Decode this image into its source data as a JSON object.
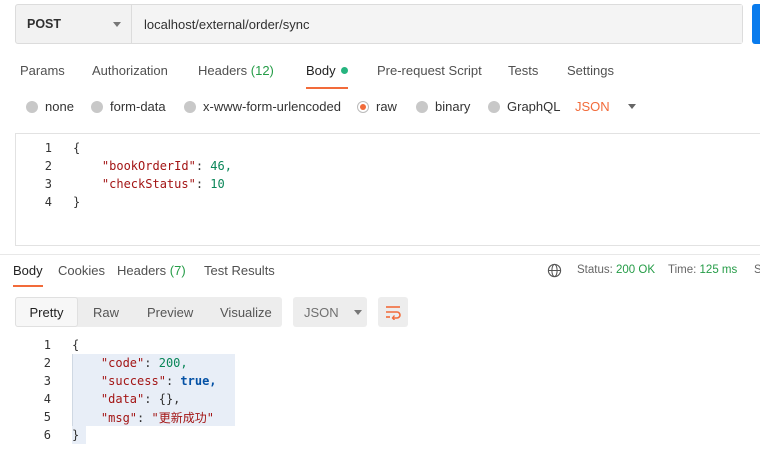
{
  "request": {
    "method": "POST",
    "url": "localhost/external/order/sync"
  },
  "request_tabs": [
    {
      "label": "Params"
    },
    {
      "label": "Authorization"
    },
    {
      "label": "Headers",
      "count": "(12)"
    },
    {
      "label": "Body",
      "active": true
    },
    {
      "label": "Pre-request Script"
    },
    {
      "label": "Tests"
    },
    {
      "label": "Settings"
    }
  ],
  "body_types": [
    {
      "label": "none"
    },
    {
      "label": "form-data"
    },
    {
      "label": "x-www-form-urlencoded"
    },
    {
      "label": "raw",
      "selected": true
    },
    {
      "label": "binary"
    },
    {
      "label": "GraphQL"
    }
  ],
  "body_format": "JSON",
  "request_body": [
    {
      "n": "1",
      "text": "{"
    },
    {
      "n": "2",
      "key": "\"bookOrderId\"",
      "value": "46,"
    },
    {
      "n": "3",
      "key": "\"checkStatus\"",
      "value": "10"
    },
    {
      "n": "4",
      "text": "}"
    }
  ],
  "response_tabs": [
    {
      "label": "Body",
      "active": true
    },
    {
      "label": "Cookies"
    },
    {
      "label": "Headers",
      "count": "(7)"
    },
    {
      "label": "Test Results"
    }
  ],
  "response_meta": {
    "status_label": "Status:",
    "status_value": "200 OK",
    "time_label": "Time:",
    "time_value": "125 ms",
    "size_label": "S"
  },
  "view_modes": [
    "Pretty",
    "Raw",
    "Preview",
    "Visualize"
  ],
  "response_format": "JSON",
  "response_body": [
    {
      "n": "1",
      "text": "{"
    },
    {
      "n": "2",
      "key": "\"code\"",
      "value": "200,"
    },
    {
      "n": "3",
      "key": "\"success\"",
      "value": "true,"
    },
    {
      "n": "4",
      "key": "\"data\"",
      "value": "{},"
    },
    {
      "n": "5",
      "key": "\"msg\"",
      "value": "\"更新成功\""
    },
    {
      "n": "6",
      "text": "}"
    }
  ],
  "colors": {
    "accent": "#f26b3a",
    "status_green": "#259c47",
    "send_blue": "#097bed"
  }
}
